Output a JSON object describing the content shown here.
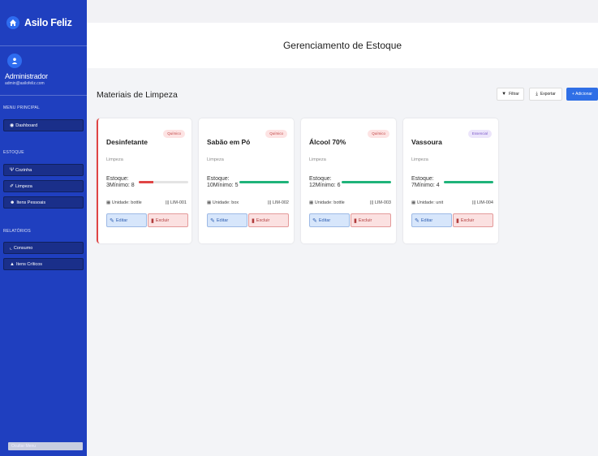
{
  "sidebar": {
    "brand": "Asilo Feliz",
    "user_name": "Administrador",
    "user_email": "admin@asilofeliz.com",
    "sections": {
      "main": "MENU PRINCIPAL",
      "stock": "ESTOQUE",
      "reports": "RELATÓRIOS"
    },
    "items": {
      "dashboard": "Dashboard",
      "cozinha": "Cozinha",
      "limpeza": "Limpeza",
      "itens_pessoais": "Itens Pessoais",
      "consumo": "Consumo",
      "itens_criticos": "Itens Críticos"
    },
    "collapse_label": "Ocultar Menu"
  },
  "header": {
    "title": "Gerenciamento de Estoque"
  },
  "section": {
    "title": "Materiais de Limpeza"
  },
  "actions": {
    "filter": "Filtrar",
    "export": "Exportar",
    "add": "+ Adicionar"
  },
  "labels": {
    "edit": "Editar",
    "delete": "Excluir"
  },
  "colors": {
    "sidebar": "#1f3fbf",
    "low_stock": "#e04545",
    "ok_stock": "#1fb37a",
    "primary": "#2f6fe6"
  },
  "cards": [
    {
      "badge": "Químico",
      "title": "Desinfetante",
      "category": "Limpeza",
      "stock_line1": "Estoque:",
      "stock_line2": "3Mínimo: 8",
      "stock_level": 0.3,
      "status": "low",
      "unit": "Unidade: bottle",
      "code": "LIM-001"
    },
    {
      "badge": "Químico",
      "title": "Sabão em Pó",
      "category": "Limpeza",
      "stock_line1": "Estoque:",
      "stock_line2": "10Mínimo: 5",
      "stock_level": 1.0,
      "status": "ok",
      "unit": "Unidade: box",
      "code": "LIM-002"
    },
    {
      "badge": "Químico",
      "title": "Álcool 70%",
      "category": "Limpeza",
      "stock_line1": "Estoque:",
      "stock_line2": "12Mínimo: 6",
      "stock_level": 1.0,
      "status": "ok",
      "unit": "Unidade: bottle",
      "code": "LIM-003"
    },
    {
      "badge": "Essencial",
      "title": "Vassoura",
      "category": "Limpeza",
      "stock_line1": "Estoque:",
      "stock_line2": "7Mínimo: 4",
      "stock_level": 1.0,
      "status": "ok",
      "unit": "Unidade: unit",
      "code": "LIM-004"
    }
  ]
}
